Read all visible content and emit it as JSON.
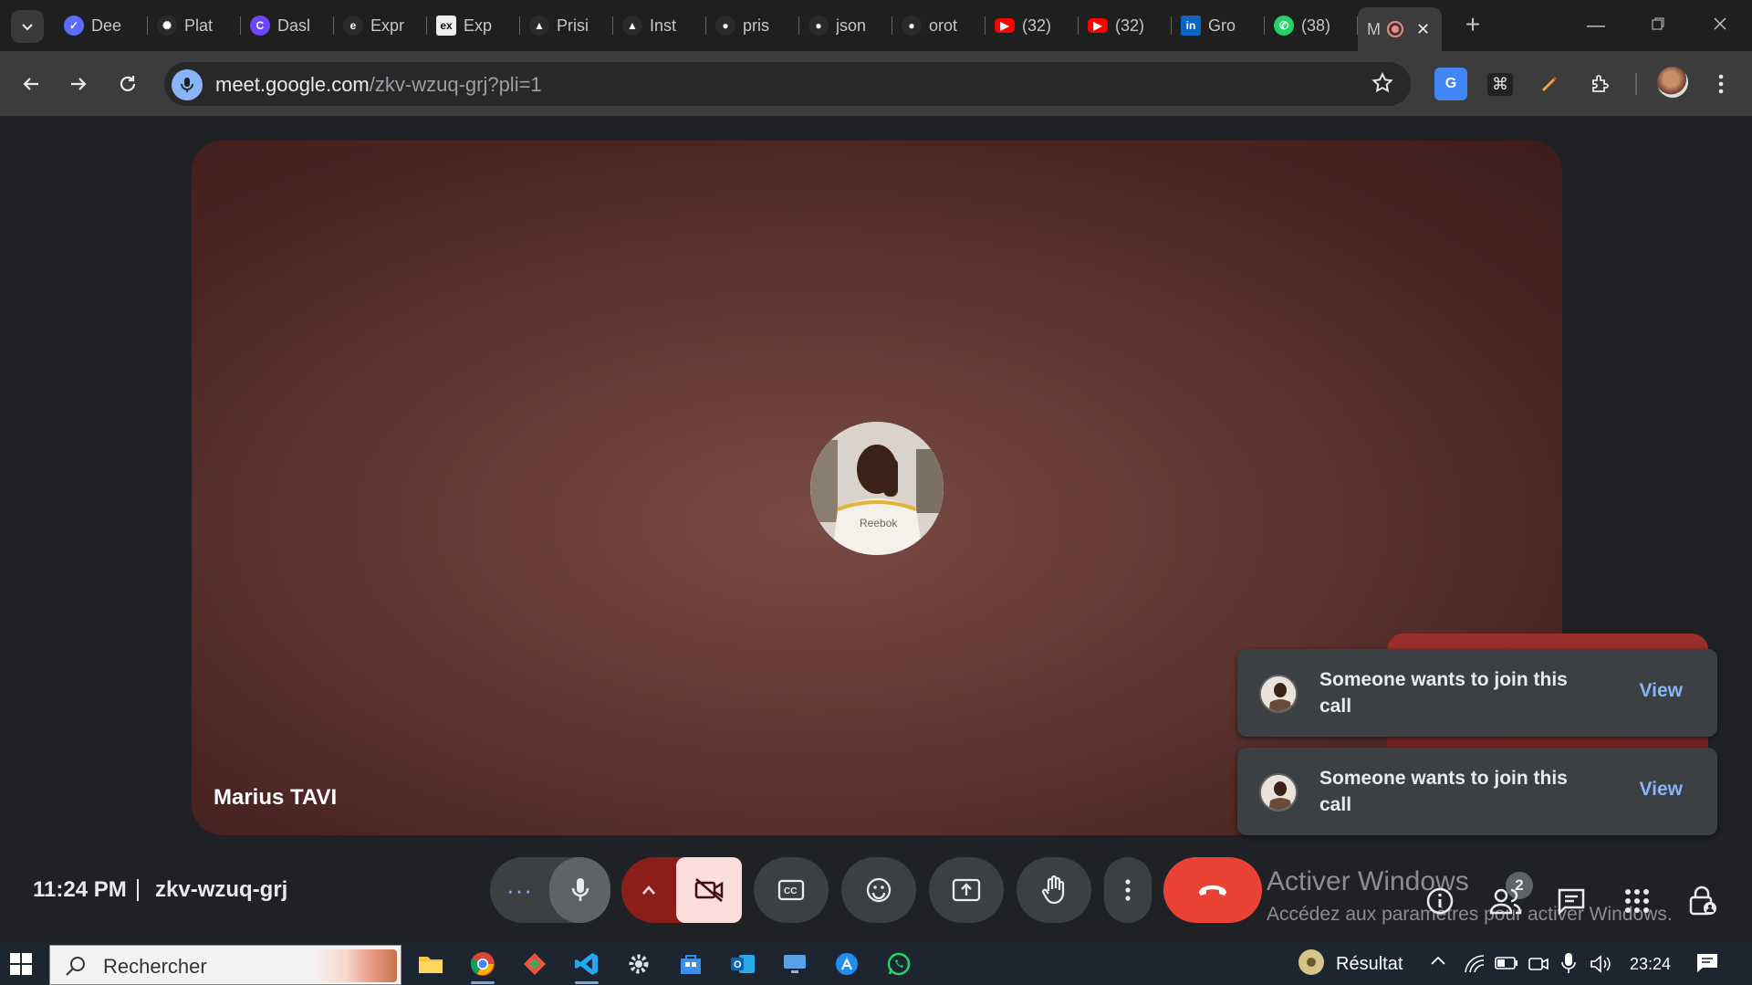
{
  "browser": {
    "tabs": [
      {
        "title": "Dee",
        "icon": "deepl-icon",
        "color": "#5b6cff"
      },
      {
        "title": "Plat",
        "icon": "openai-icon",
        "color": "#2a2a2a"
      },
      {
        "title": "Dasl",
        "icon": "dash-icon",
        "color": "#6c47ff"
      },
      {
        "title": "Expr",
        "icon": "expo-icon",
        "color": "#2a2a2a"
      },
      {
        "title": "Exp",
        "icon": "express-icon",
        "color": "#eeeeee"
      },
      {
        "title": "Prisi",
        "icon": "prisma-icon",
        "color": "#2a2a2a"
      },
      {
        "title": "Inst",
        "icon": "prisma-icon",
        "color": "#2a2a2a"
      },
      {
        "title": "pris",
        "icon": "github-icon",
        "color": "#2a2a2a"
      },
      {
        "title": "json",
        "icon": "github-icon",
        "color": "#2a2a2a"
      },
      {
        "title": "orot",
        "icon": "github-icon",
        "color": "#2a2a2a"
      },
      {
        "title": "(32)",
        "icon": "youtube-icon",
        "color": "#ff0000"
      },
      {
        "title": "(32)",
        "icon": "youtube-icon",
        "color": "#ff0000"
      },
      {
        "title": "Gro",
        "icon": "linkedin-icon",
        "color": "#0a66c2"
      },
      {
        "title": "(38)",
        "icon": "whatsapp-icon",
        "color": "#25d366"
      }
    ],
    "active_tab": {
      "title": "M",
      "icon": "recording-icon"
    },
    "url_host": "meet.google.com",
    "url_path": "/zkv-wzuq-grj?pli=1"
  },
  "meet": {
    "participant_name": "Marius TAVI",
    "notifications": [
      {
        "message": "Someone wants to join this call",
        "action": "View"
      },
      {
        "message": "Someone wants to join this call",
        "action": "View"
      }
    ],
    "time": "11:24 PM",
    "meeting_code": "zkv-wzuq-grj",
    "people_count": "2",
    "colors": {
      "end_call": "#ea4335",
      "camera_off_bg": "#f9dedc",
      "camera_group_bg": "#8c1d18",
      "link": "#8ab4f8"
    }
  },
  "watermark": {
    "title": "Activer Windows",
    "subtitle": "Accédez aux paramètres pour activer Windows."
  },
  "taskbar": {
    "search_placeholder": "Rechercher",
    "weather_text": "Résultat",
    "clock": "23:24"
  }
}
